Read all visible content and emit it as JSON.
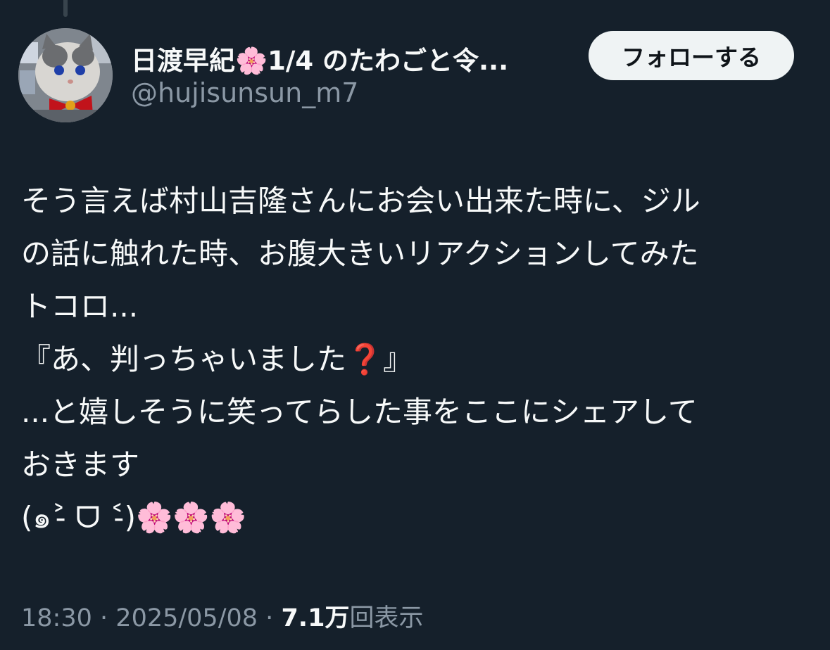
{
  "author": {
    "display_name": "日渡早紀🌸1/4 のたわごと令...",
    "handle": "@hujisunsun_m7",
    "avatar_icon": "cat-plush-avatar"
  },
  "follow_button": {
    "label": "フォローする"
  },
  "tweet": {
    "lines": [
      "そう言えば村山吉隆さんにお会い出来た時に、ジル",
      "の話に触れた時、お腹大きいリアクションしてみた",
      "トコロ...",
      "『あ、判っちゃいました❓』",
      "...と嬉しそうに笑ってらした事をここにシェアして",
      "おきます",
      "(๑˃̵ ᗜ ˂̵)🌸🌸🌸"
    ]
  },
  "meta": {
    "time": "18:30",
    "separator": "·",
    "date": "2025/05/08",
    "views_count": "7.1万",
    "views_label": "回表示"
  },
  "colors": {
    "background": "#15202b",
    "text_primary": "#f7f9f9",
    "text_secondary": "#8b98a5",
    "button_bg": "#eff3f4"
  }
}
